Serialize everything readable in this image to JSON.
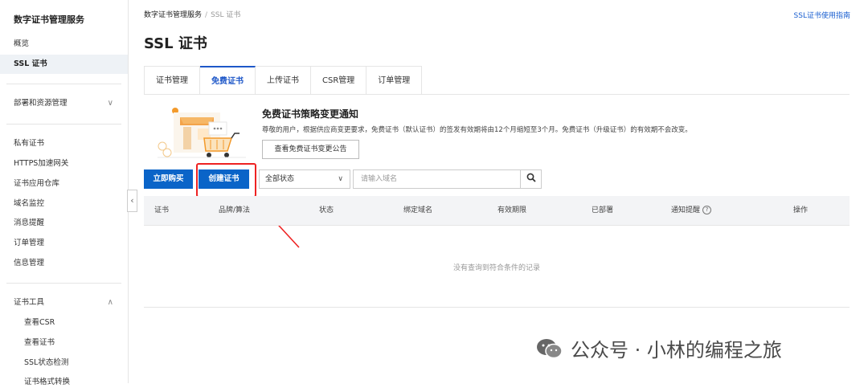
{
  "sidebar": {
    "title": "数字证书管理服务",
    "overview": "概览",
    "ssl": "SSL 证书",
    "deploy": "部署和资源管理",
    "private_cert": "私有证书",
    "https_gateway": "HTTPS加速网关",
    "cert_repo": "证书应用仓库",
    "domain_monitor": "域名监控",
    "message_alert": "消息提醒",
    "order_mgmt": "订单管理",
    "info_mgmt": "信息管理",
    "tools": "证书工具",
    "view_csr": "查看CSR",
    "view_cert": "查看证书",
    "ssl_check": "SSL状态检测",
    "format_convert": "证书格式转换"
  },
  "breadcrumb": {
    "root": "数字证书管理服务",
    "sep": "/",
    "current": "SSL 证书"
  },
  "guide_link": "SSL证书使用指南",
  "page_title": "SSL 证书",
  "tabs": [
    "证书管理",
    "免费证书",
    "上传证书",
    "CSR管理",
    "订单管理"
  ],
  "notice": {
    "title": "免费证书策略变更通知",
    "text": "尊敬的用户，根据供应商变更要求，免费证书（默认证书）的签发有效期将由12个月缩短至3个月。免费证书（升级证书）的有效期不会改变。",
    "button": "查看免费证书变更公告"
  },
  "actions": {
    "buy": "立即购买",
    "create": "创建证书"
  },
  "filter": {
    "status": "全部状态",
    "search_placeholder": "请输入域名"
  },
  "table": {
    "headers": [
      "证书",
      "品牌/算法",
      "状态",
      "绑定域名",
      "有效期限",
      "已部署",
      "通知提醒",
      "操作"
    ],
    "empty": "没有查询到符合条件的记录"
  },
  "watermark": "公众号 · 小林的编程之旅",
  "colors": {
    "primary": "#0a64c8",
    "highlight": "#e22222",
    "tab_active": "#1e57c8"
  }
}
